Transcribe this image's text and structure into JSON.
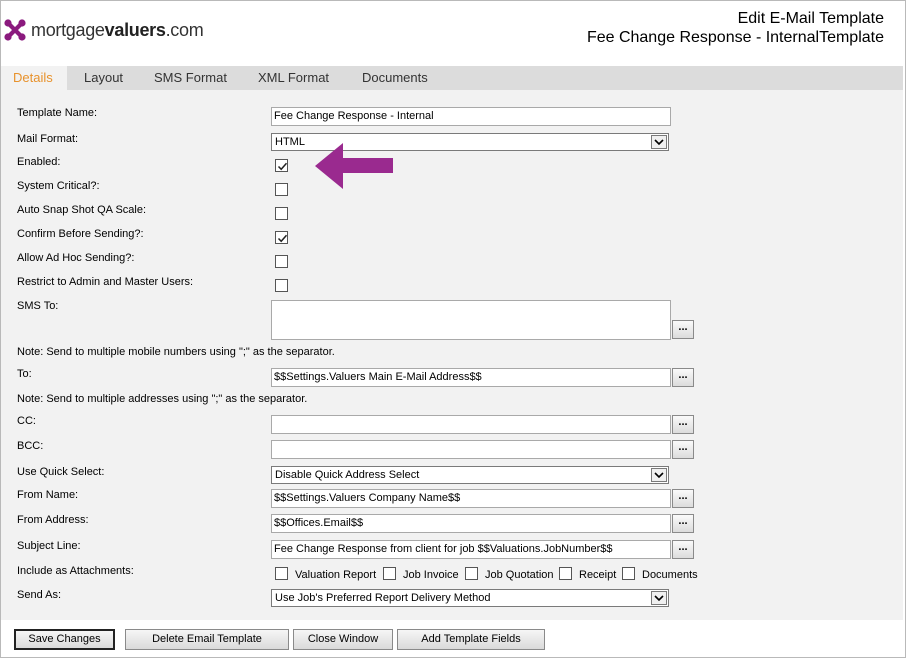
{
  "header": {
    "logo_regular": "mortgage",
    "logo_bold": "valuers",
    "logo_suffix": ".com",
    "title_line1": "Edit E-Mail Template",
    "title_line2": "Fee Change Response - InternalTemplate"
  },
  "tabs": [
    {
      "label": "Details",
      "active": true
    },
    {
      "label": "Layout",
      "active": false
    },
    {
      "label": "SMS Format",
      "active": false
    },
    {
      "label": "XML Format",
      "active": false
    },
    {
      "label": "Documents",
      "active": false
    }
  ],
  "form": {
    "template_name": {
      "label": "Template Name:",
      "value": "Fee Change Response - Internal"
    },
    "mail_format": {
      "label": "Mail Format:",
      "value": "HTML"
    },
    "enabled": {
      "label": "Enabled:",
      "checked": true
    },
    "system_critical": {
      "label": "System Critical?:",
      "checked": false
    },
    "auto_snap": {
      "label": "Auto Snap Shot QA Scale:",
      "checked": false
    },
    "confirm_before": {
      "label": "Confirm Before Sending?:",
      "checked": true
    },
    "allow_adhoc": {
      "label": "Allow Ad Hoc Sending?:",
      "checked": false
    },
    "restrict_admin": {
      "label": "Restrict to Admin and Master Users:",
      "checked": false
    },
    "sms_to": {
      "label": "SMS To:",
      "value": ""
    },
    "sms_note": "Note: Send to multiple mobile numbers using \";\" as the separator.",
    "to": {
      "label": "To:",
      "value": "$$Settings.Valuers Main E-Mail Address$$"
    },
    "to_note": "Note: Send to multiple addresses using \";\" as the separator.",
    "cc": {
      "label": "CC:",
      "value": ""
    },
    "bcc": {
      "label": "BCC:",
      "value": ""
    },
    "quick_select": {
      "label": "Use Quick Select:",
      "value": "Disable Quick Address Select"
    },
    "from_name": {
      "label": "From Name:",
      "value": "$$Settings.Valuers Company Name$$"
    },
    "from_address": {
      "label": "From Address:",
      "value": "$$Offices.Email$$"
    },
    "subject_line": {
      "label": "Subject Line:",
      "value": "Fee Change Response from client for job $$Valuations.JobNumber$$"
    },
    "attachments": {
      "label": "Include as Attachments:",
      "options": [
        {
          "label": "Valuation Report",
          "checked": false
        },
        {
          "label": "Job Invoice",
          "checked": false
        },
        {
          "label": "Job Quotation",
          "checked": false
        },
        {
          "label": "Receipt",
          "checked": false
        },
        {
          "label": "Documents",
          "checked": false
        }
      ]
    },
    "send_as": {
      "label": "Send As:",
      "value": "Use Job's Preferred Report Delivery Method"
    },
    "ellipsis_label": "..."
  },
  "buttons": {
    "save": "Save Changes",
    "delete": "Delete Email Template",
    "close": "Close Window",
    "add_fields": "Add Template Fields"
  },
  "colors": {
    "active_tab_text": "#e8922c",
    "logo_purple": "#8b1a7e",
    "arrow_purple": "#9a2a8f",
    "tab_bar_bg": "#dcdcdc",
    "panel_bg": "#f2f2f2"
  },
  "icons": {
    "logo": "cross-logo-icon",
    "checkmark": "checkmark-icon",
    "dropdown": "chevron-down-icon",
    "annotation": "left-arrow-icon"
  }
}
